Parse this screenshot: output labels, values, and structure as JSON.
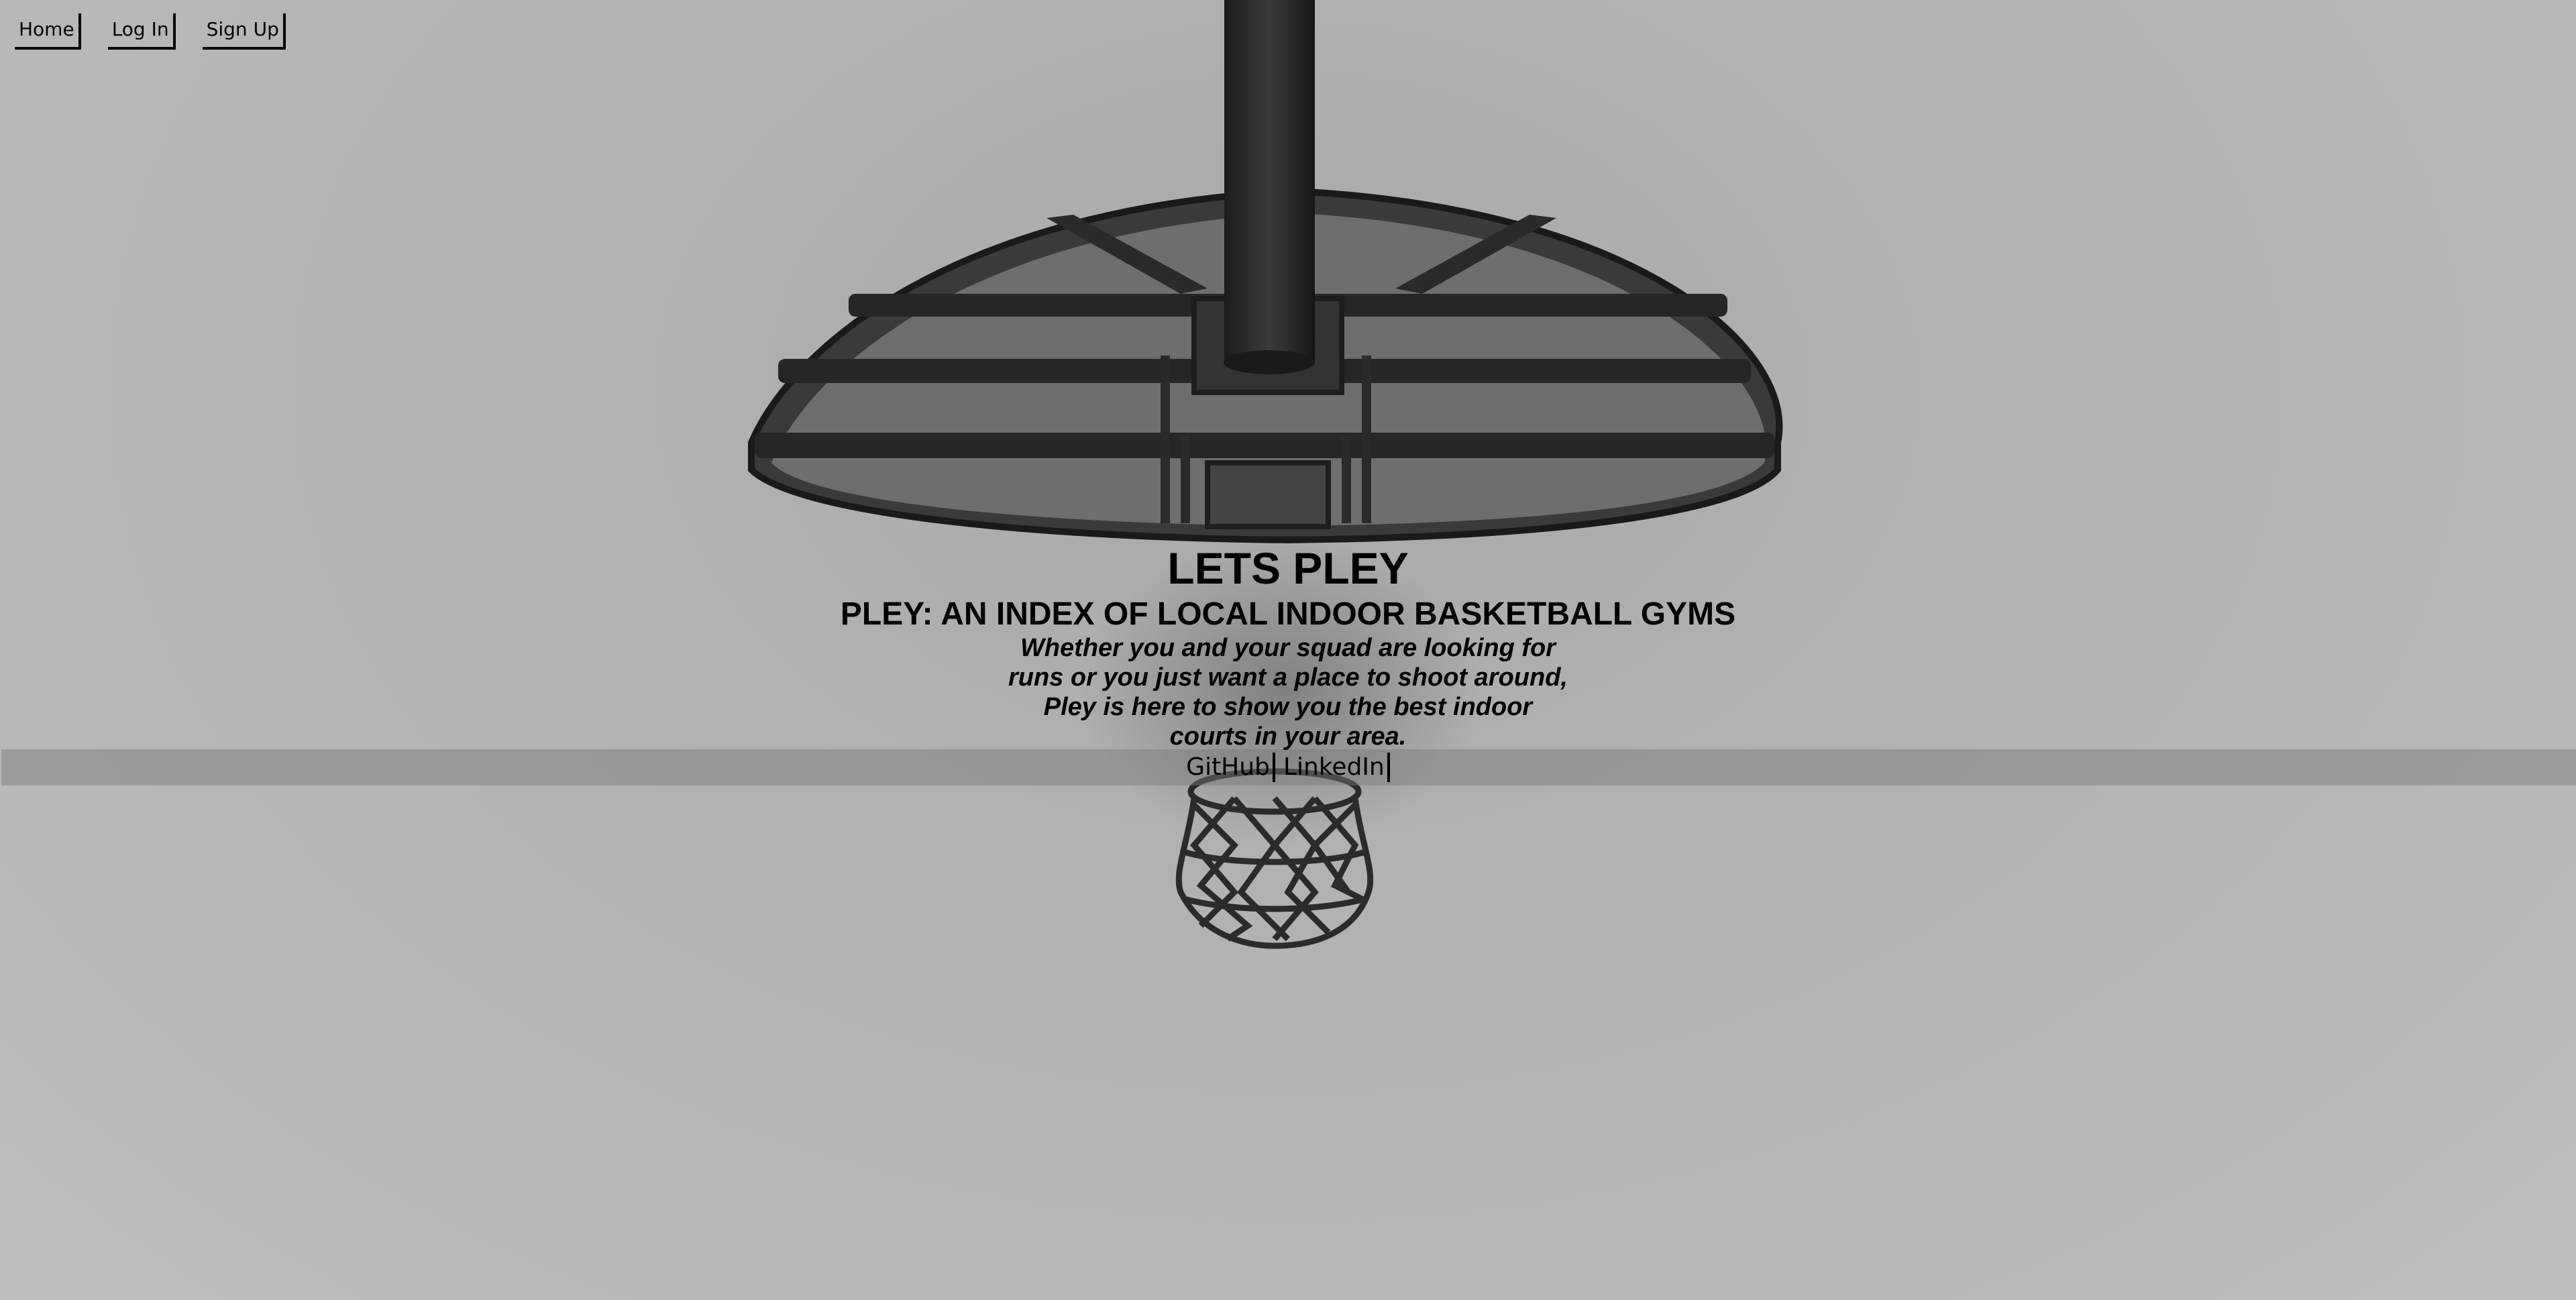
{
  "nav": {
    "items": [
      {
        "label": "Home"
      },
      {
        "label": "Log In"
      },
      {
        "label": "Sign Up"
      }
    ]
  },
  "hero": {
    "title": "LETS PLEY",
    "subtitle": "PLEY: AN INDEX OF LOCAL INDOOR BASKETBALL GYMS",
    "description_lines": [
      "Whether you and your squad are looking for",
      "runs or you just want a place to shoot around,",
      "Pley is here to show you the best indoor",
      "courts in your area."
    ]
  },
  "links": {
    "github": "GitHub",
    "linkedin": "LinkedIn"
  },
  "colors": {
    "background": "#b5b5b5",
    "text": "#000000",
    "band": "#8f8f8f"
  }
}
